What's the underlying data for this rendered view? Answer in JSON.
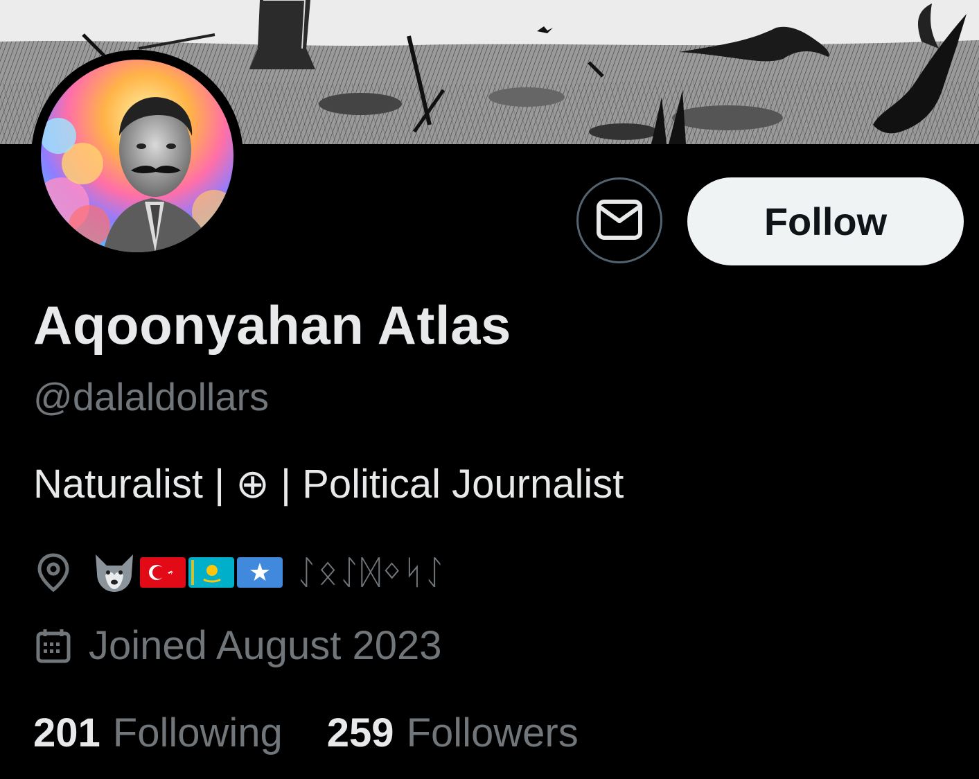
{
  "profile": {
    "display_name": "Aqoonyahan Atlas",
    "handle": "@dalaldollars",
    "bio": "Naturalist | ⊕ | Political Journalist",
    "location": {
      "icon": "location-pin-icon",
      "emoji": [
        "wolf",
        "flag-turkey",
        "flag-kazakhstan",
        "flag-somalia"
      ],
      "runic_text": "ᛇᛟᛇᛞᛜᛋᛇ"
    },
    "joined": {
      "icon": "calendar-icon",
      "text": "Joined August 2023"
    }
  },
  "actions": {
    "message_icon": "envelope-icon",
    "follow_label": "Follow"
  },
  "stats": {
    "following_count": "201",
    "following_label": "Following",
    "followers_count": "259",
    "followers_label": "Followers"
  },
  "colors": {
    "background": "#000000",
    "primary_text": "#e7e9ea",
    "secondary_text": "#71767b",
    "button_border": "#536471",
    "follow_bg": "#eff3f4",
    "follow_text": "#0f1419"
  }
}
